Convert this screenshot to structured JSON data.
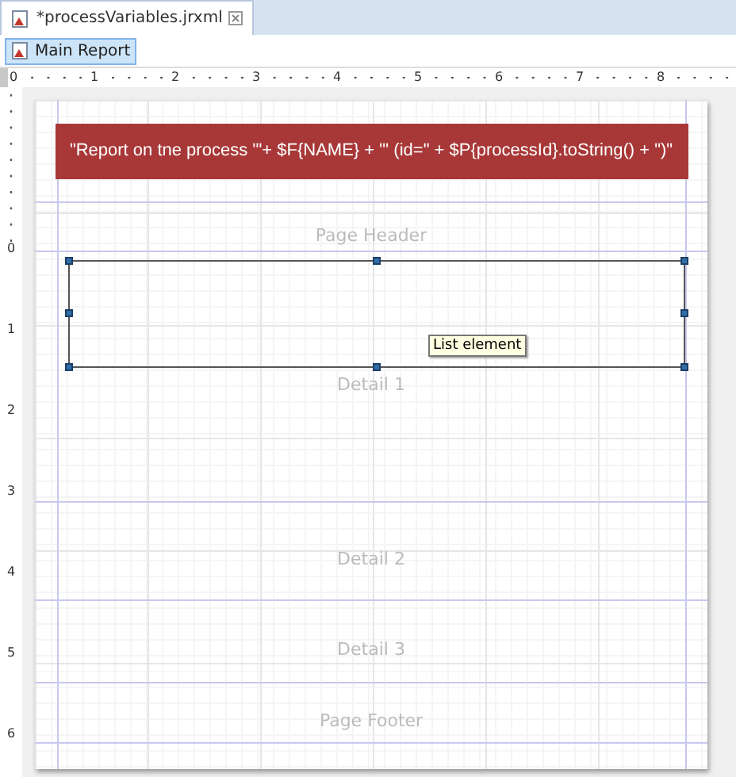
{
  "tab": {
    "title": "*processVariables.jrxml"
  },
  "toolbar": {
    "buttons": [
      {
        "label": "Main Report",
        "selected": true
      }
    ]
  },
  "ruler": {
    "horizontal_marks": [
      "0",
      "1",
      "2",
      "3",
      "4",
      "5",
      "6",
      "7",
      "8"
    ],
    "vertical_marks": [
      "0",
      "1",
      "2",
      "3",
      "4",
      "5",
      "6"
    ]
  },
  "report": {
    "title_field": {
      "expression": "\"Report on tne process '\"+ $F{NAME} + \"' (id=\" + $P{processId}.toString() + \")\""
    },
    "bands": [
      {
        "label": "Page Header"
      },
      {
        "label": "Detail 1"
      },
      {
        "label": "Detail 2"
      },
      {
        "label": "Detail 3"
      },
      {
        "label": "Page Footer"
      }
    ],
    "list_element": {
      "tooltip": "List element",
      "selected": true
    }
  }
}
